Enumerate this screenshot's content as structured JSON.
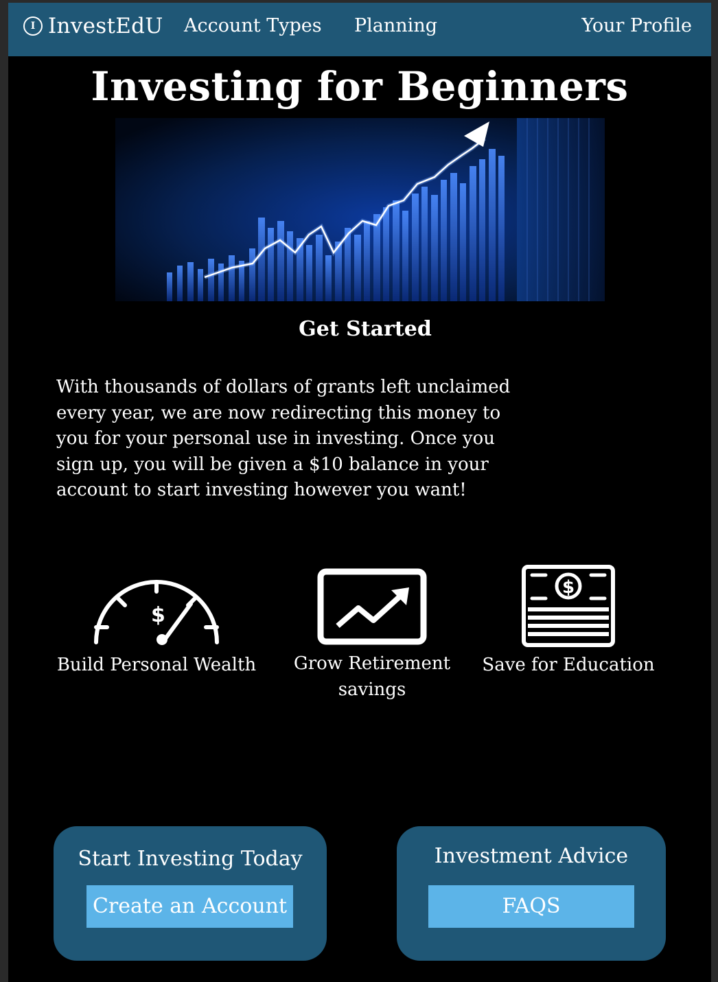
{
  "nav": {
    "brand_icon_letter": "I",
    "brand_icon": "coin-icon",
    "brand": "InvestEdU",
    "links": [
      "Account Types",
      "Planning"
    ],
    "profile": "Your Profile",
    "background": "#1f5776"
  },
  "main": {
    "title": "Investing for Beginners",
    "hero_image": "stock-growth-chart-image",
    "subtitle": "Get Started",
    "intro": "With thousands of dollars of grants left unclaimed every year, we are now redirecting this money to you for your personal use in investing. Once you sign up, you will be given a $10 balance in your account to start investing however you want!"
  },
  "features": [
    {
      "icon": "speedometer-dollar-icon",
      "label": "Build Personal Wealth"
    },
    {
      "icon": "trending-chart-icon",
      "label": "Grow Retirement savings"
    },
    {
      "icon": "cash-stack-icon",
      "label": "Save for Education"
    }
  ],
  "cards": {
    "start": {
      "title": "Start Investing Today",
      "button": "Create an Account"
    },
    "advice": {
      "title": "Investment Advice",
      "button": "FAQS"
    }
  },
  "colors": {
    "page_background": "#000000",
    "card_background": "#1f5776",
    "button_background": "#5cb4e8"
  }
}
